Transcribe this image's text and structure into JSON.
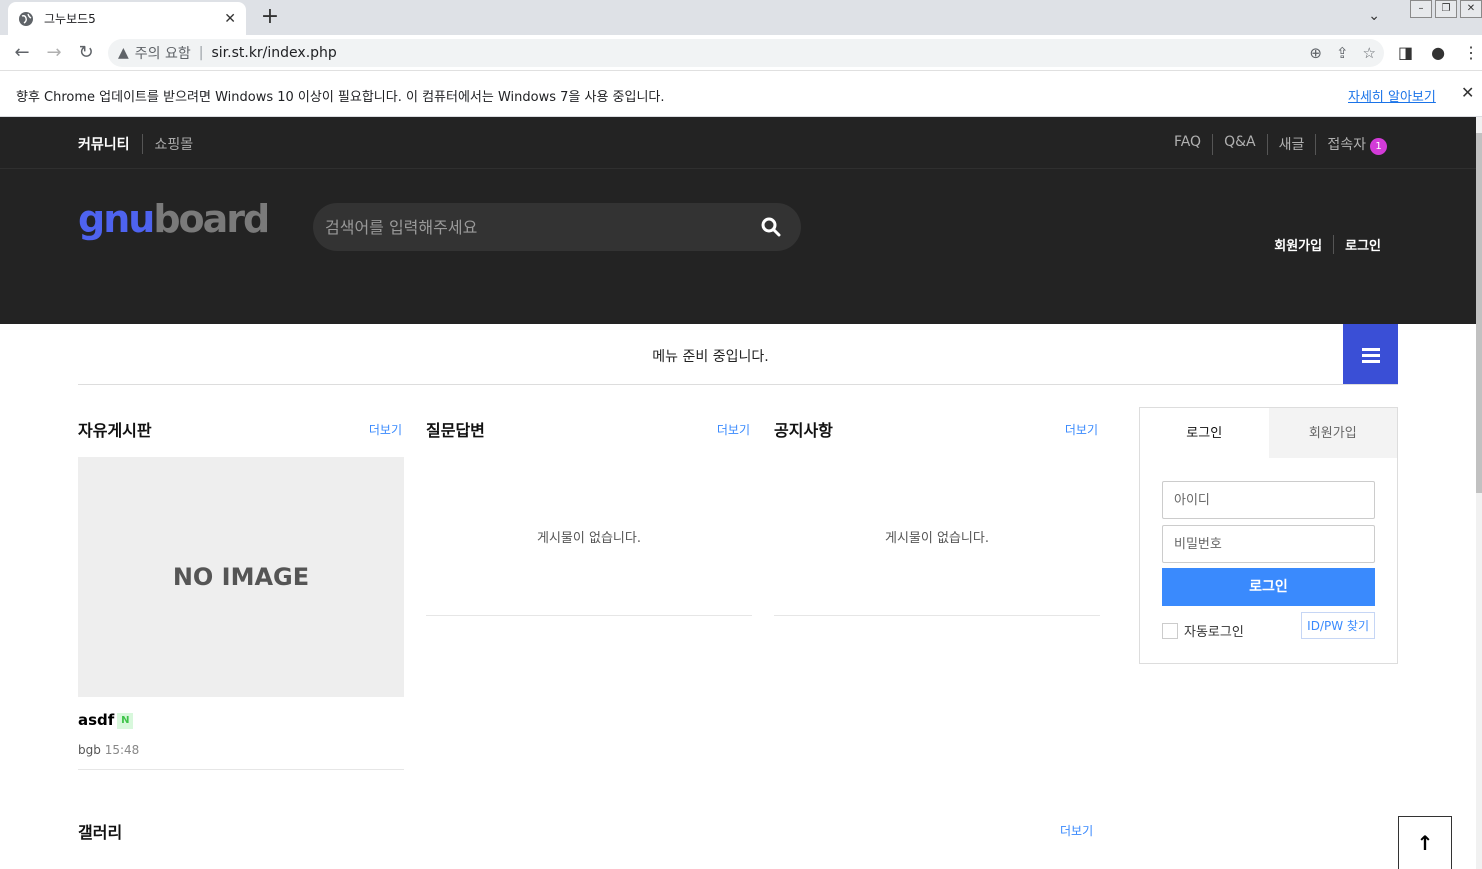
{
  "browser": {
    "tab_title": "그누보드5",
    "tab_close": "✕",
    "new_tab": "+",
    "security_label": "주의 요함",
    "url": "sir.st.kr/index.php",
    "infobar_message": "향후 Chrome 업데이트를 받으려면 Windows 10 이상이 필요합니다. 이 컴퓨터에서는 Windows 7을 사용 중입니다.",
    "infobar_link": "자세히 알아보기",
    "infobar_close": "✕"
  },
  "topnav": {
    "left": [
      "커뮤니티",
      "쇼핑몰"
    ],
    "right": [
      "FAQ",
      "Q&A",
      "새글",
      "접속자"
    ],
    "visitor_count": "1"
  },
  "header": {
    "logo_part1": "gnu",
    "logo_part2": "board",
    "search_placeholder": "검색어를 입력해주세요",
    "links": [
      "회원가입",
      "로그인"
    ]
  },
  "menubar": {
    "message": "메뉴 준비 중입니다."
  },
  "boards": [
    {
      "title": "자유게시판",
      "more": "더보기",
      "no_image": "NO IMAGE",
      "post": {
        "title": "asdf",
        "new_tag": "N",
        "author": "bgb",
        "time": "15:48"
      }
    },
    {
      "title": "질문답변",
      "more": "더보기",
      "empty": "게시물이 없습니다."
    },
    {
      "title": "공지사항",
      "more": "더보기",
      "empty": "게시물이 없습니다."
    }
  ],
  "login": {
    "tab_login": "로그인",
    "tab_register": "회원가입",
    "id_placeholder": "아이디",
    "pw_placeholder": "비밀번호",
    "submit": "로그인",
    "auto_login": "자동로그인",
    "find": "ID/PW 찾기"
  },
  "gallery": {
    "title": "갤러리",
    "more": "더보기"
  },
  "colors": {
    "accent": "#3a4fd6",
    "button": "#3a8afd",
    "dark_bg": "#232323",
    "badge": "#d33bd8"
  }
}
